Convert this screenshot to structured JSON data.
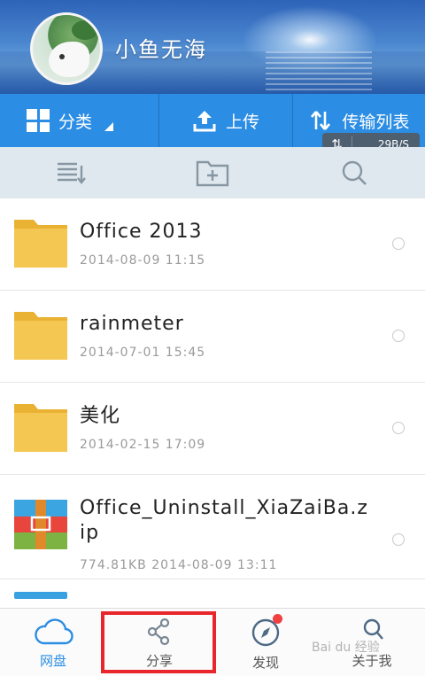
{
  "header": {
    "username": "小鱼无海"
  },
  "actionbar": {
    "category_label": "分类",
    "upload_label": "上传",
    "transfer_label": "传输列表",
    "speed": "29B/S"
  },
  "toolbar": {
    "icons": [
      "sort-icon",
      "new-folder-icon",
      "search-icon"
    ]
  },
  "files": [
    {
      "name": "Office 2013",
      "meta": "2014-08-09  11:15",
      "type": "folder"
    },
    {
      "name": "rainmeter",
      "meta": "2014-07-01  15:45",
      "type": "folder"
    },
    {
      "name": "美化",
      "meta": "2014-02-15  17:09",
      "type": "folder"
    },
    {
      "name": "Office_Uninstall_XiaZaiBa.zip",
      "meta": "774.81KB  2014-08-09  13:11",
      "type": "zip"
    }
  ],
  "bottomnav": {
    "items": [
      {
        "label": "网盘",
        "icon": "cloud-icon"
      },
      {
        "label": "分享",
        "icon": "share-icon"
      },
      {
        "label": "发现",
        "icon": "compass-icon"
      },
      {
        "label": "关于我",
        "icon": "user-icon"
      }
    ]
  },
  "watermark": "Bai du 经验",
  "colors": {
    "accent": "#2b8de3",
    "folder": "#f0c24a",
    "highlight": "#e8262b",
    "badge": "#f04040"
  }
}
